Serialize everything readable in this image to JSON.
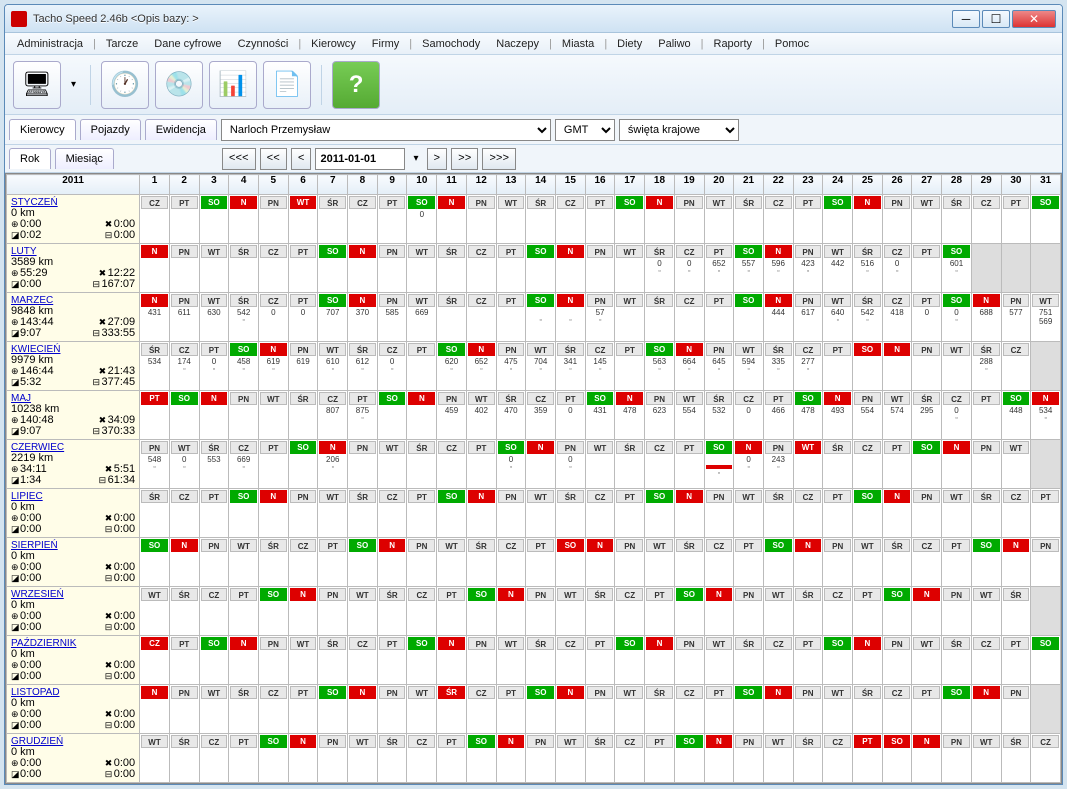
{
  "window": {
    "title": "Tacho Speed 2.46b <Opis bazy: >"
  },
  "menu": [
    "Administracja",
    "|",
    "Tarcze",
    "Dane cyfrowe",
    "Czynności",
    "|",
    "Kierowcy",
    "Firmy",
    "|",
    "Samochody",
    "Naczepy",
    "|",
    "Miasta",
    "|",
    "Diety",
    "Paliwo",
    "|",
    "Raporty",
    "|",
    "Pomoc"
  ],
  "tabs": {
    "kierowcy": "Kierowcy",
    "pojazdy": "Pojazdy",
    "ewidencja": "Ewidencja"
  },
  "driver": "Narloch  Przemysław",
  "tz": "GMT",
  "holidays": "święta krajowe",
  "periodTabs": {
    "rok": "Rok",
    "miesiac": "Miesiąc"
  },
  "nav": {
    "first": "<<<",
    "prev2": "<<",
    "prev": "<",
    "date": "2011-01-01",
    "next": ">",
    "next2": ">>",
    "last": ">>>"
  },
  "year": "2011",
  "dows": [
    "SO",
    "N",
    "PN",
    "WT",
    "ŚR",
    "CZ",
    "PT"
  ],
  "months": [
    {
      "name": "STYCZEŃ",
      "km": "0 km",
      "a": "0:00",
      "b": "0:00",
      "c": "0:02",
      "d": "0:00",
      "start": 5,
      "days": 31,
      "vals": {
        "10": "0"
      },
      "red": {
        "6": 1
      },
      "marks": {}
    },
    {
      "name": "LUTY",
      "km": "3589 km",
      "a": "55:29",
      "b": "12:22",
      "c": "0:00",
      "d": "167:07",
      "start": 1,
      "days": 28,
      "vals": {
        "18": "0",
        "19": "0",
        "20": "652",
        "21": "557",
        "22": "596",
        "23": "423",
        "24": "442",
        "25": "516",
        "26": "0",
        "28": "601"
      },
      "marks": {
        "18": 1,
        "19": 1,
        "20": 1,
        "21": 1,
        "22": 1,
        "23": 1,
        "25": 1,
        "26": 1,
        "28": 1
      }
    },
    {
      "name": "MARZEC",
      "km": "9848 km",
      "a": "143:44",
      "b": "27:09",
      "c": "9:07",
      "d": "333:55",
      "start": 1,
      "days": 31,
      "vals": {
        "1": "431",
        "2": "611",
        "3": "630",
        "4": "542",
        "5": "0",
        "6": "0",
        "7": "707",
        "8": "370",
        "9": "585",
        "10": "669",
        "16": "57",
        "22": "444",
        "23": "617",
        "24": "640",
        "25": "542",
        "26": "418",
        "27": "0",
        "28": "0",
        "29": "688",
        "30": "577",
        "31": "751"
      },
      "marks": {
        "4": 1,
        "14": 1,
        "15": 1,
        "16": 1,
        "24": 1,
        "25": 1,
        "28": 1
      },
      "sub": {
        "31": "569"
      }
    },
    {
      "name": "KWIECIEŃ",
      "km": "9979 km",
      "a": "146:44",
      "b": "21:43",
      "c": "5:32",
      "d": "377:45",
      "start": 4,
      "days": 30,
      "vals": {
        "1": "534",
        "2": "174",
        "3": "0",
        "4": "458",
        "5": "619",
        "6": "619",
        "7": "610",
        "8": "612",
        "9": "0",
        "11": "620",
        "12": "652",
        "13": "475",
        "14": "704",
        "15": "341",
        "16": "145",
        "18": "563",
        "19": "664",
        "20": "645",
        "21": "594",
        "22": "335",
        "23": "277",
        "29": "288"
      },
      "marks": {
        "2": 1,
        "3": 1,
        "4": 1,
        "5": 1,
        "7": 1,
        "8": 1,
        "9": 1,
        "11": 1,
        "12": 1,
        "13": 1,
        "14": 1,
        "15": 1,
        "16": 1,
        "18": 1,
        "19": 1,
        "20": 1,
        "21": 1,
        "22": 1,
        "23": 1,
        "29": 1
      },
      "red": {
        "25": 1
      }
    },
    {
      "name": "MAJ",
      "km": "10238 km",
      "a": "140:48",
      "b": "34:09",
      "c": "9:07",
      "d": "370:33",
      "start": 6,
      "days": 31,
      "vals": {
        "7": "807",
        "8": "875",
        "11": "459",
        "12": "402",
        "13": "470",
        "14": "359",
        "15": "0",
        "16": "431",
        "17": "478",
        "18": "623",
        "19": "554",
        "20": "532",
        "21": "0",
        "22": "466",
        "23": "478",
        "24": "493",
        "25": "554",
        "26": "574",
        "27": "295",
        "28": "0",
        "30": "448",
        "31": "534"
      },
      "marks": {
        "8": 1,
        "28": 1,
        "31": 1
      },
      "red": {
        "1": 1,
        "3": 1
      }
    },
    {
      "name": "CZERWIEC",
      "km": "2219 km",
      "a": "34:11",
      "b": "5:51",
      "c": "1:34",
      "d": "61:34",
      "start": 2,
      "days": 30,
      "vals": {
        "1": "548",
        "2": "0",
        "3": "553",
        "4": "669",
        "7": "206",
        "13": "0",
        "15": "0",
        "21": "0",
        "22": "243"
      },
      "marks": {
        "1": 1,
        "2": 1,
        "4": 1,
        "7": 1,
        "13": 1,
        "15": 1,
        "20": 1,
        "21": 1,
        "22": 1
      },
      "red": {
        "23": 1
      },
      "bar": {
        "20": 1
      }
    },
    {
      "name": "LIPIEC",
      "km": "0 km",
      "a": "0:00",
      "b": "0:00",
      "c": "0:00",
      "d": "0:00",
      "start": 4,
      "days": 31
    },
    {
      "name": "SIERPIEŃ",
      "km": "0 km",
      "a": "0:00",
      "b": "0:00",
      "c": "0:00",
      "d": "0:00",
      "start": 0,
      "days": 31,
      "red": {
        "15": 1
      }
    },
    {
      "name": "WRZESIEŃ",
      "km": "0 km",
      "a": "0:00",
      "b": "0:00",
      "c": "0:00",
      "d": "0:00",
      "start": 3,
      "days": 30
    },
    {
      "name": "PAŹDZIERNIK",
      "km": "0 km",
      "a": "0:00",
      "b": "0:00",
      "c": "0:00",
      "d": "0:00",
      "start": 5,
      "days": 31,
      "red": {
        "1": 1
      }
    },
    {
      "name": "LISTOPAD",
      "km": "0 km",
      "a": "0:00",
      "b": "0:00",
      "c": "0:00",
      "d": "0:00",
      "start": 1,
      "days": 30,
      "red": {
        "1": 1,
        "11": 1
      }
    },
    {
      "name": "GRUDZIEŃ",
      "km": "0 km",
      "a": "0:00",
      "b": "0:00",
      "c": "0:00",
      "d": "0:00",
      "start": 3,
      "days": 31,
      "red": {
        "25": 1,
        "26": 1
      }
    }
  ]
}
